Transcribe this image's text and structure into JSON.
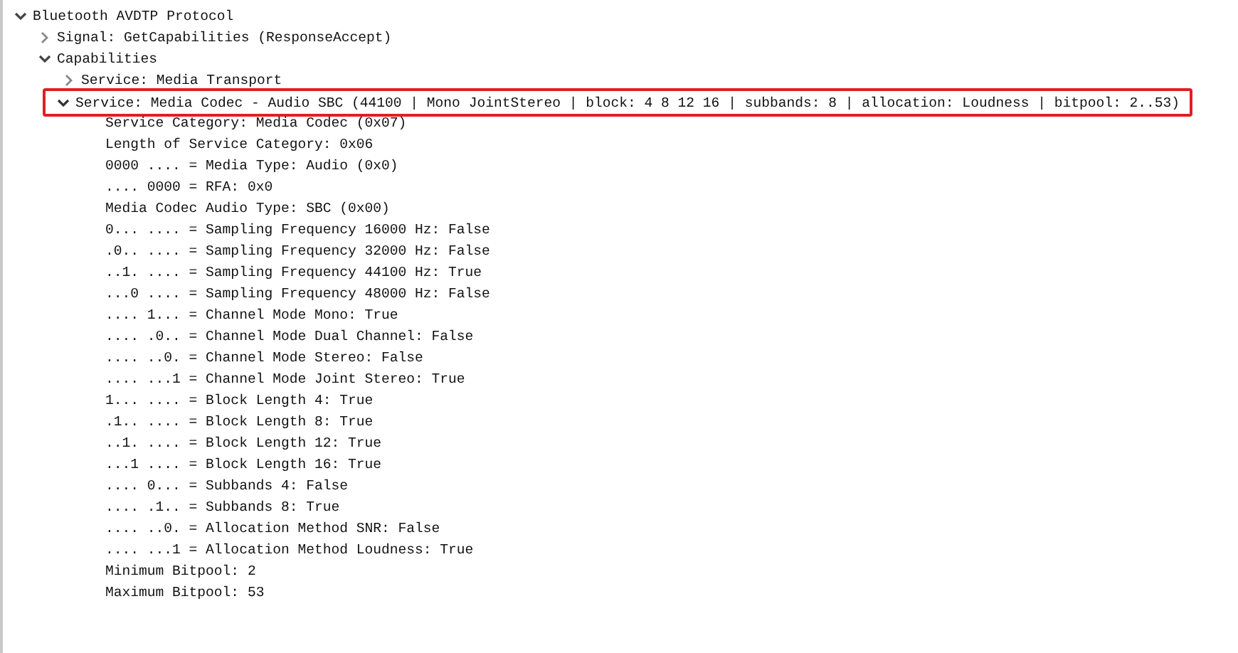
{
  "tree": [
    {
      "label": "Bluetooth AVDTP Protocol",
      "expanded": true,
      "children": [
        {
          "label": "Signal: GetCapabilities (ResponseAccept)",
          "expanded": false
        },
        {
          "label": "Capabilities",
          "expanded": true,
          "children": [
            {
              "label": "Service: Media Transport",
              "expanded": false
            },
            {
              "label": "Service: Media Codec - Audio SBC (44100 | Mono JointStereo | block: 4 8 12 16 | subbands: 8 | allocation: Loudness | bitpool: 2..53)",
              "expanded": true,
              "highlighted": true,
              "children": [
                {
                  "label": "Service Category: Media Codec (0x07)"
                },
                {
                  "label": "Length of Service Category: 0x06"
                },
                {
                  "label": "0000 .... = Media Type: Audio (0x0)"
                },
                {
                  "label": ".... 0000 = RFA: 0x0"
                },
                {
                  "label": "Media Codec Audio Type: SBC (0x00)"
                },
                {
                  "label": "0... .... = Sampling Frequency 16000 Hz: False"
                },
                {
                  "label": ".0.. .... = Sampling Frequency 32000 Hz: False"
                },
                {
                  "label": "..1. .... = Sampling Frequency 44100 Hz: True"
                },
                {
                  "label": "...0 .... = Sampling Frequency 48000 Hz: False"
                },
                {
                  "label": ".... 1... = Channel Mode Mono: True"
                },
                {
                  "label": ".... .0.. = Channel Mode Dual Channel: False"
                },
                {
                  "label": ".... ..0. = Channel Mode Stereo: False"
                },
                {
                  "label": ".... ...1 = Channel Mode Joint Stereo: True"
                },
                {
                  "label": "1... .... = Block Length 4: True"
                },
                {
                  "label": ".1.. .... = Block Length 8: True"
                },
                {
                  "label": "..1. .... = Block Length 12: True"
                },
                {
                  "label": "...1 .... = Block Length 16: True"
                },
                {
                  "label": ".... 0... = Subbands 4: False"
                },
                {
                  "label": ".... .1.. = Subbands 8: True"
                },
                {
                  "label": ".... ..0. = Allocation Method SNR: False"
                },
                {
                  "label": ".... ...1 = Allocation Method Loudness: True"
                },
                {
                  "label": "Minimum Bitpool: 2"
                },
                {
                  "label": "Maximum Bitpool: 53"
                }
              ]
            }
          ]
        }
      ]
    }
  ]
}
